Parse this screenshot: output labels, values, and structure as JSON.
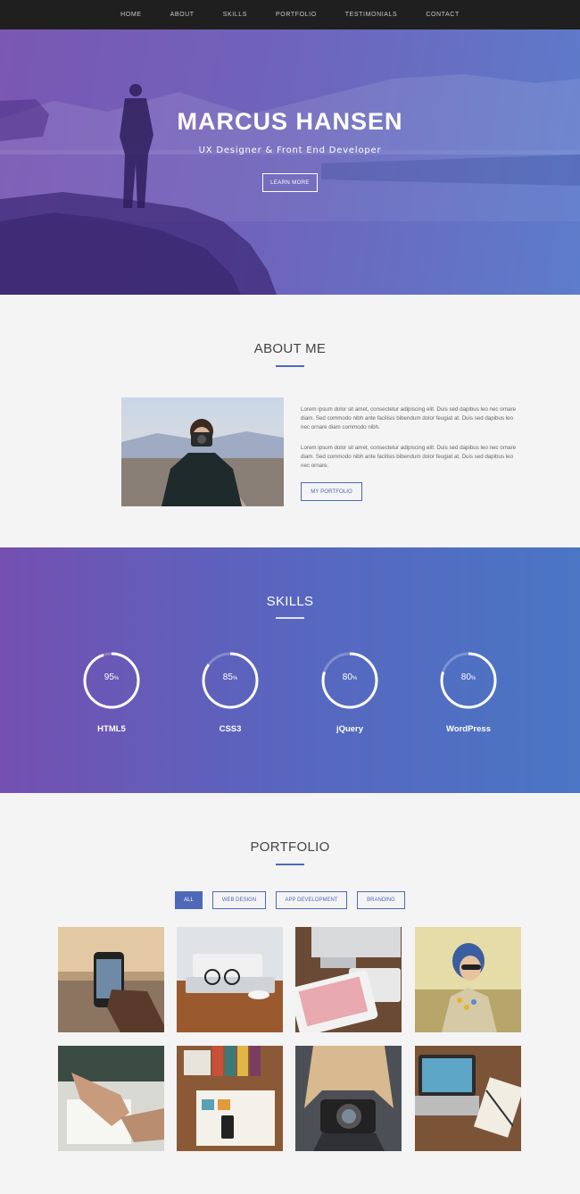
{
  "nav": {
    "items": [
      "HOME",
      "ABOUT",
      "SKILLS",
      "PORTFOLIO",
      "TESTIMONIALS",
      "CONTACT"
    ]
  },
  "hero": {
    "title": "MARCUS HANSEN",
    "subtitle": "UX Designer & Front End Developer",
    "button": "LEARN MORE"
  },
  "about": {
    "title": "ABOUT ME",
    "paragraph_1": "Lorem ipsum dolor sit amet, consectetur adipiscing elit. Duis sed dapibus leo nec ornare diam. Sed commodo nibh ante facilisis bibendum dolor feugiat at. Duis sed dapibus leo nec ornare diam commodo nibh.",
    "paragraph_2": "Lorem ipsum dolor sit amet, consectetur adipiscing elit. Duis sed dapibus leo nec ornare diam. Sed commodo nibh ante facilisis bibendum dolor feugiat at. Duis sed dapibus leo nec ornare.",
    "button": "MY PORTFOLIO"
  },
  "skills": {
    "title": "SKILLS",
    "items": [
      {
        "name": "HTML5",
        "value": "95",
        "unit": "%",
        "level": 0.95
      },
      {
        "name": "CSS3",
        "value": "85",
        "unit": "%",
        "level": 0.85
      },
      {
        "name": "jQuery",
        "value": "80",
        "unit": "%",
        "level": 0.8
      },
      {
        "name": "WordPress",
        "value": "80",
        "unit": "%",
        "level": 0.8
      }
    ]
  },
  "portfolio": {
    "title": "PORTFOLIO",
    "filters": [
      "ALL",
      "WEB DESIGN",
      "APP DEVELOPMENT",
      "BRANDING"
    ],
    "active_filter": "ALL"
  },
  "colors": {
    "accent": "#4e69b8",
    "nav_bg": "#1f1f1f",
    "gradient_start": "#7450b1",
    "gradient_end": "#4a76c4"
  }
}
